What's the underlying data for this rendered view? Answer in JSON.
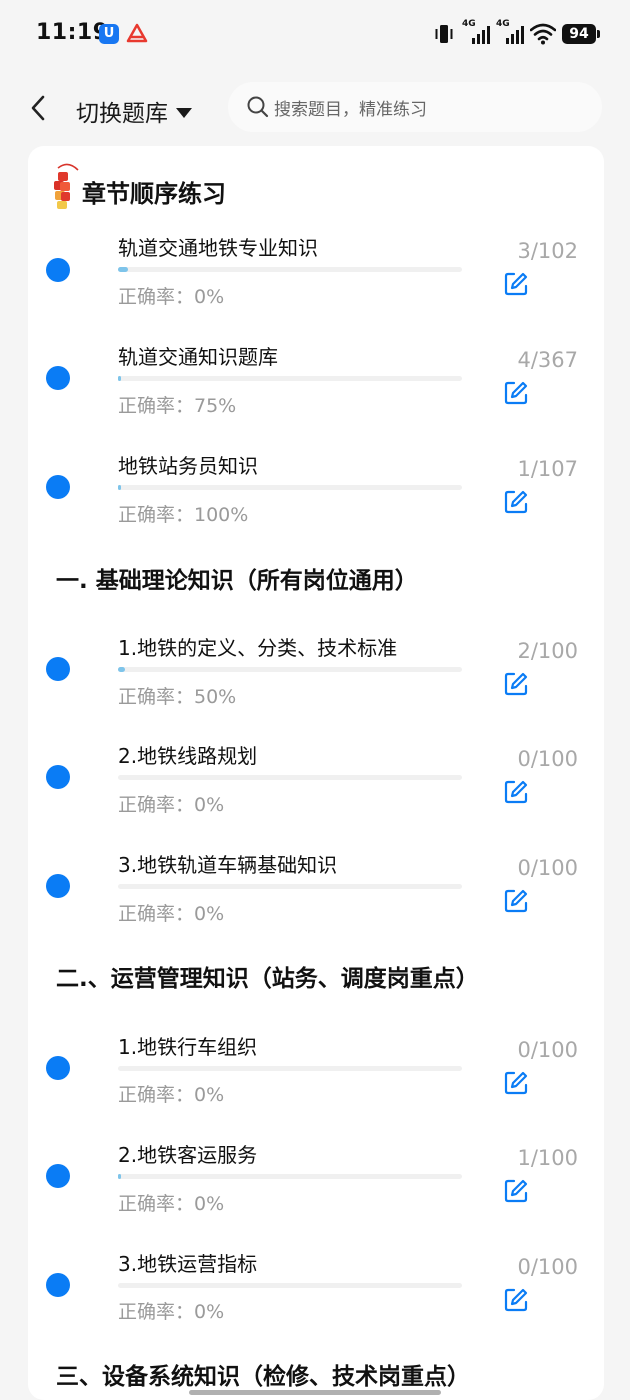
{
  "status_bar": {
    "time": "11:19",
    "app_icon_1_glyph": "U",
    "network_labels": [
      "4G",
      "4G"
    ],
    "battery": "94"
  },
  "header": {
    "back_icon": "chevron-left-icon",
    "switch_label": "切换题库",
    "search_placeholder": "搜索题目，精准练习"
  },
  "main_section": {
    "title": "章节顺序练习",
    "icon": "firecracker-icon",
    "items": [
      {
        "title": "轨道交通地铁专业知识",
        "rate": "正确率：0%",
        "count": "3/102",
        "progress": 0.03
      },
      {
        "title": "轨道交通知识题库",
        "rate": "正确率：75%",
        "count": "4/367",
        "progress": 0.01
      },
      {
        "title": "地铁站务员知识",
        "rate": "正确率：100%",
        "count": "1/107",
        "progress": 0.01
      }
    ]
  },
  "sections": [
    {
      "title": "一. 基础理论知识（所有岗位通用）",
      "items": [
        {
          "title": "1.地铁的定义、分类、技术标准",
          "rate": "正确率：50%",
          "count": "2/100",
          "progress": 0.02
        },
        {
          "title": "2.地铁线路规划",
          "rate": "正确率：0%",
          "count": "0/100",
          "progress": 0
        },
        {
          "title": "3.地铁轨道车辆基础知识",
          "rate": "正确率：0%",
          "count": "0/100",
          "progress": 0
        }
      ]
    },
    {
      "title": "二.、运营管理知识（站务、调度岗重点）",
      "items": [
        {
          "title": "1.地铁行车组织",
          "rate": "正确率：0%",
          "count": "0/100",
          "progress": 0
        },
        {
          "title": "2.地铁客运服务",
          "rate": "正确率：0%",
          "count": "1/100",
          "progress": 0.01
        },
        {
          "title": "3.地铁运营指标",
          "rate": "正确率：0%",
          "count": "0/100",
          "progress": 0
        }
      ]
    },
    {
      "title": "三、设备系统知识（检修、技术岗重点）",
      "items": []
    }
  ],
  "colors": {
    "accent": "#0a7cf5",
    "progress_fill": "#7ec4ea",
    "heading_underline": "#d5ebfb"
  }
}
